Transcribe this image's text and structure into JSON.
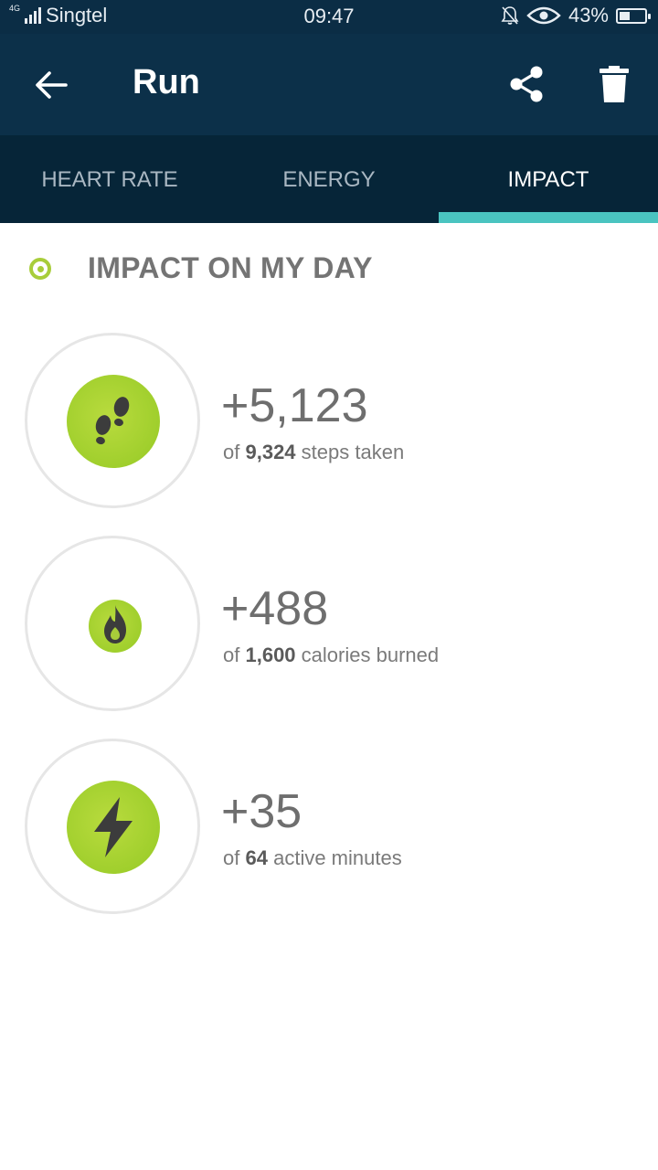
{
  "status_bar": {
    "network_type": "4G",
    "carrier": "Singtel",
    "time": "09:47",
    "battery": "43%",
    "battery_level": 0.43,
    "icons": [
      "signal-icon",
      "mute-icon",
      "eye-icon",
      "battery-icon"
    ]
  },
  "app_bar": {
    "title": "Run",
    "icons": [
      "back-arrow-icon",
      "share-icon",
      "delete-icon"
    ]
  },
  "tabs": [
    {
      "label": "HEART RATE",
      "active": false
    },
    {
      "label": "ENERGY",
      "active": false
    },
    {
      "label": "IMPACT",
      "active": true
    }
  ],
  "section": {
    "title": "IMPACT ON MY DAY"
  },
  "stats": [
    {
      "icon": "footsteps-icon",
      "value": "+5,123",
      "prefix": "of",
      "total": "9,324",
      "suffix": "steps taken"
    },
    {
      "icon": "flame-icon",
      "value": "+488",
      "prefix": "of",
      "total": "1,600",
      "suffix": "calories burned"
    },
    {
      "icon": "lightning-bolt-icon",
      "value": "+35",
      "prefix": "of",
      "total": "64",
      "suffix": "active minutes"
    }
  ],
  "colors": {
    "status_bar_bg": "#0b2d45",
    "app_bar_bg": "#0c3049",
    "tabs_bg": "#062538",
    "tab_indicator": "#4ac4c0",
    "accent_green": "#a8cd3a",
    "text_gray": "#6e6e6e"
  }
}
